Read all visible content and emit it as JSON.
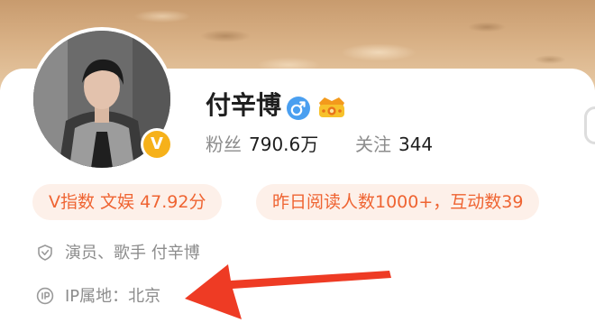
{
  "profile": {
    "name": "付辛博",
    "verify_mark": "V",
    "gender_icon": "male-icon",
    "vip_icon": "vip-crown-icon"
  },
  "stats": {
    "fans_label": "粉丝",
    "fans_value": "790.6万",
    "follow_label": "关注",
    "follow_value": "344"
  },
  "badges": {
    "v_index": "V指数 文娱 47.92分",
    "reads": "昨日阅读人数1000+，互动数39"
  },
  "info": {
    "role": "演员、歌手 付辛博",
    "ip": "IP属地：北京"
  },
  "colors": {
    "accent": "#ef6432",
    "pill_bg": "#fdf0e9",
    "verify": "#f6b11a",
    "gender": "#4a9ff0",
    "annotation_arrow": "#ee3b24"
  }
}
